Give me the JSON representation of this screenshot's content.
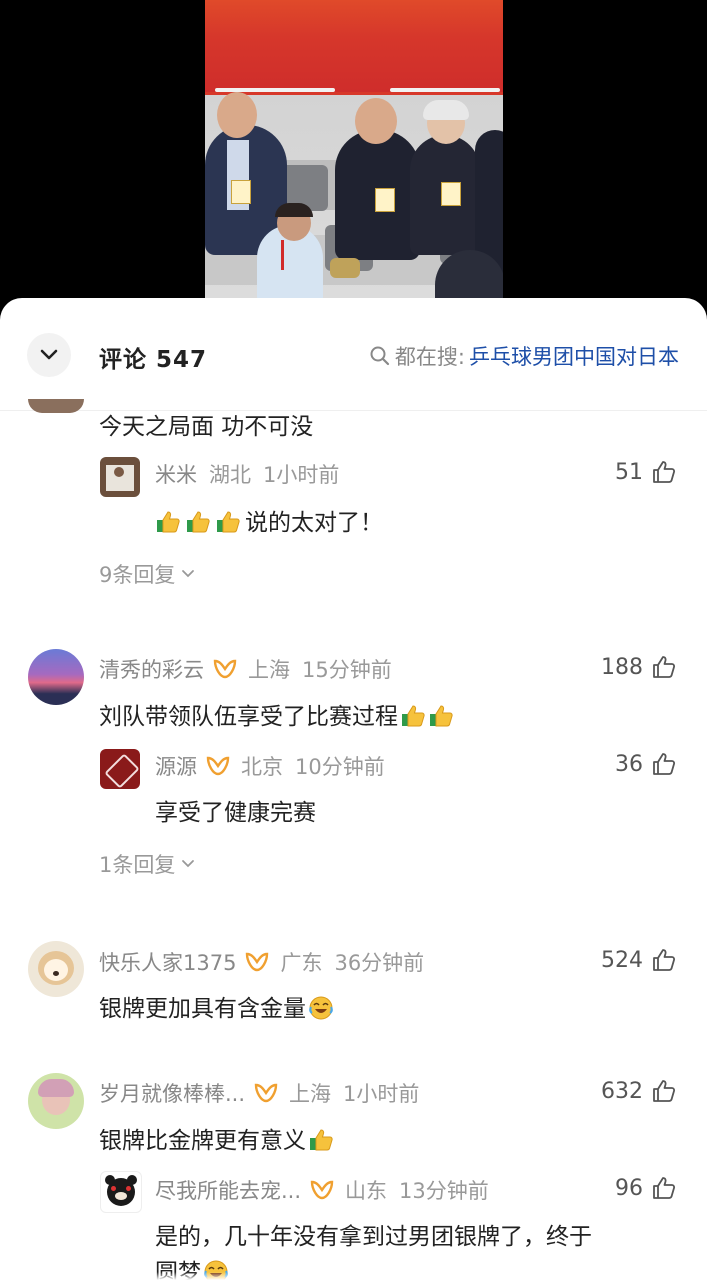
{
  "video": {
    "description_icons": [
      "spectator-scene"
    ]
  },
  "sheet": {
    "title": "评论 547",
    "search_prefix": "都在搜:",
    "search_keyword": "乒乓球男团中国对日本",
    "collapse_icon": "chevron-down-icon"
  },
  "comments": {
    "c0": {
      "text_tail": "今天之局面  功不可没",
      "reply": {
        "user": "米米",
        "location": "湖北",
        "time": "1小时前",
        "likes": "51",
        "text": "说的太对了！"
      },
      "more_replies": "9条回复"
    },
    "c1": {
      "user": "清秀的彩云",
      "location": "上海",
      "time": "15分钟前",
      "likes": "188",
      "text": "刘队带领队伍享受了比赛过程",
      "reply": {
        "user": "源源",
        "location": "北京",
        "time": "10分钟前",
        "likes": "36",
        "text": "享受了健康完赛"
      },
      "more_replies": "1条回复"
    },
    "c2": {
      "user": "快乐人家1375",
      "location": "广东",
      "time": "36分钟前",
      "likes": "524",
      "text": "银牌更加具有含金量"
    },
    "c3": {
      "user": "岁月就像棒棒...",
      "location": "上海",
      "time": "1小时前",
      "likes": "632",
      "text": "银牌比金牌更有意义",
      "reply": {
        "user": "尽我所能去宠...",
        "location": "山东",
        "time": "13分钟前",
        "likes": "96",
        "text_line1": "是的，几十年没有拿到过男团银牌了，终于",
        "text_line2": "圆梦"
      }
    }
  },
  "colors": {
    "accent_link": "#1e4fa8",
    "vip_badge": "#f0a030",
    "muted_text": "#999999"
  }
}
